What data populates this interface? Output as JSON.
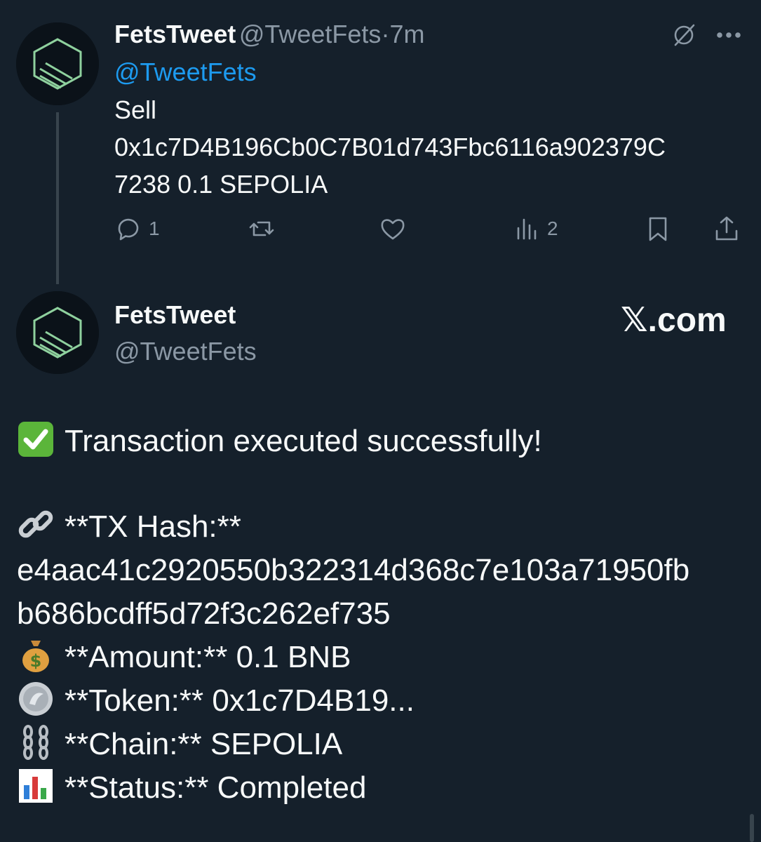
{
  "tweet": {
    "display_name": "FetsTweet",
    "handle": "@TweetFets",
    "separator": "·",
    "time": "7m",
    "mention": "@TweetFets",
    "line1": "Sell",
    "line2": "0x1c7D4B196Cb0C7B01d743Fbc6116a902379C",
    "line3": "7238 0.1 SEPOLIA",
    "actions": {
      "reply_count": "1",
      "views_count": "2"
    },
    "icons": {
      "grok": "grok-slash-icon",
      "more": "more-dots-icon",
      "reply": "reply-icon",
      "retweet": "retweet-icon",
      "like": "like-heart-icon",
      "views": "views-bar-icon",
      "bookmark": "bookmark-icon",
      "share": "share-icon"
    }
  },
  "card": {
    "display_name": "FetsTweet",
    "handle": "@TweetFets",
    "brand": "𝕏.com",
    "success": "Transaction executed successfully!",
    "tx_label": "**TX Hash:**",
    "tx_hash_1": "e4aac41c2920550b322314d368c7e103a71950fb",
    "tx_hash_2": "b686bcdff5d72f3c262ef735",
    "amount": "**Amount:** 0.1 BNB",
    "token": "**Token:** 0x1c7D4B19...",
    "chain": "**Chain:** SEPOLIA",
    "status": "**Status:** Completed",
    "icons": {
      "check": "check-mark-emoji-icon",
      "link": "link-emoji-icon",
      "money": "money-bag-emoji-icon",
      "coin": "coin-emoji-icon",
      "chains": "chains-emoji-icon",
      "chart": "bar-chart-emoji-icon"
    }
  },
  "colors": {
    "background": "#15202b",
    "text": "#f7f9f9",
    "secondary": "#8b98a5",
    "accent": "#1d9bf0",
    "logo_green": "#8fd19e"
  }
}
